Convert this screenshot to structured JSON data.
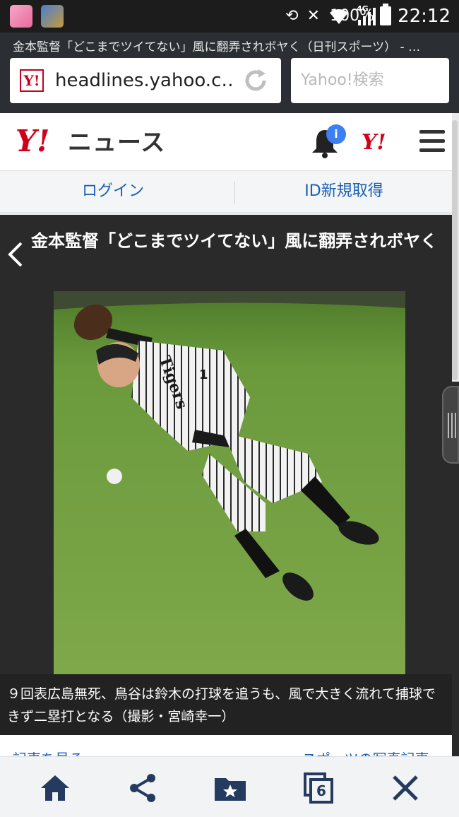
{
  "status_bar": {
    "signal_label": "4G",
    "battery_percent": "100%",
    "time": "22:12"
  },
  "browser": {
    "tab_title": "金本監督「どこまでツイてない」風に翻弄されボヤく（日刊スポーツ） - …",
    "url": "headlines.yahoo.c…",
    "search_placeholder": "Yahoo!検索",
    "favicon_text": "Y!"
  },
  "header": {
    "logo": "Y!",
    "title": "ニュース",
    "notification_count": "i",
    "yahoo_small": "Y!"
  },
  "login_bar": {
    "login": "ログイン",
    "signup": "ID新規取得"
  },
  "article": {
    "title": "金本監督「どこまでツイてない」風に翻弄されボヤく",
    "caption": "９回表広島無死、鳥谷は鈴木の打球を追うも、風で大きく流れて捕球できず二塁打となる（撮影・宮崎幸一）",
    "jersey_text": "Tigers",
    "jersey_number": "1"
  },
  "below_links": {
    "left": "記事を見る",
    "right": "スポーツの写真記事"
  },
  "toolbar": {
    "tabs_count": "6"
  },
  "colors": {
    "yahoo_red": "#d0021b",
    "link_blue": "#1a5fb4",
    "badge_blue": "#3b7ff2"
  }
}
